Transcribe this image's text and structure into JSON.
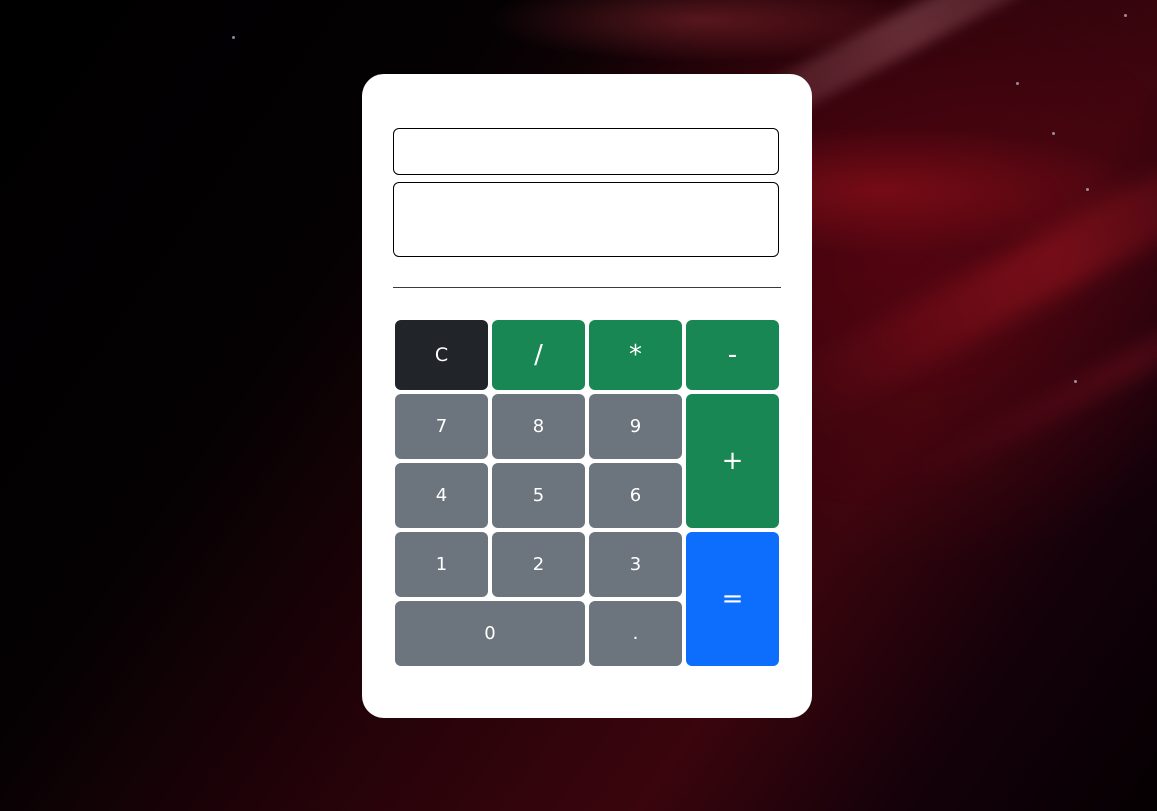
{
  "calculator": {
    "expression_value": "",
    "result_value": "",
    "keys": {
      "clear": "C",
      "divide": "/",
      "multiply": "*",
      "subtract": "-",
      "add": "+",
      "equals": "=",
      "decimal": ".",
      "seven": "7",
      "eight": "8",
      "nine": "9",
      "four": "4",
      "five": "5",
      "six": "6",
      "one": "1",
      "two": "2",
      "three": "3",
      "zero": "0"
    }
  },
  "colors": {
    "card_background": "#ffffff",
    "clear_key": "#212529",
    "operator_key": "#198754",
    "number_key": "#6c757d",
    "equals_key": "#0d6efd"
  }
}
